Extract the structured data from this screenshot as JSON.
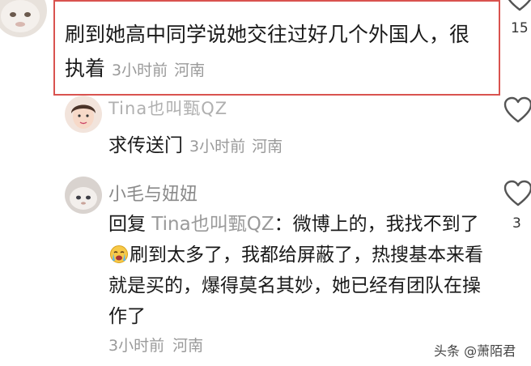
{
  "comments": [
    {
      "username": "",
      "text": "刷到她高中同学说她交往过好几个外国人，很执着",
      "time": "3小时前",
      "location": "河南",
      "likes": "15"
    },
    {
      "username": "Tina也叫甄QZ",
      "text": "求传送门",
      "time": "3小时前",
      "location": "河南",
      "likes": ""
    },
    {
      "username": "小毛与妞妞",
      "reply_prefix": "回复",
      "reply_to": "Tina也叫甄QZ",
      "text_before_emoji": "：微博上的，我找不到了",
      "emoji": "crying-face-emoji",
      "text_after_emoji": "刷到太多了，我都给屏蔽了，热搜基本来看就是买的，爆得莫名其妙，她已经有团队在操作了",
      "time": "3小时前",
      "location": "河南",
      "likes": "3"
    }
  ],
  "watermark": "头条 @萧陌君",
  "colors": {
    "highlight_border": "#d9534f",
    "meta_text": "#9a9a9a",
    "username": "#8a8a8a"
  }
}
